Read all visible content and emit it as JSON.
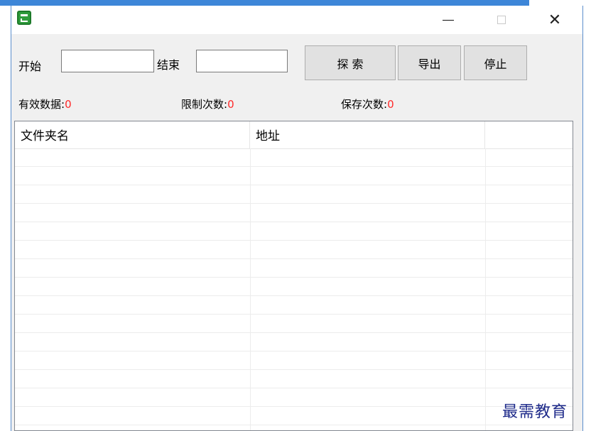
{
  "window": {
    "minimize_glyph": "—",
    "maximize_glyph": "□",
    "close_glyph": "✕"
  },
  "form": {
    "start_label": "开始",
    "start_value": "",
    "end_label": "结束",
    "end_value": ""
  },
  "buttons": {
    "search": "探 索",
    "export": "导出",
    "stop": "停止"
  },
  "stats": {
    "valid_label": "有效数据:",
    "valid_value": "0",
    "limit_label": "限制次数:",
    "limit_value": "0",
    "save_label": "保存次数:",
    "save_value": "0"
  },
  "table": {
    "columns": [
      "文件夹名",
      "地址",
      ""
    ],
    "rows": []
  },
  "watermark": "最需教育",
  "colors": {
    "accent": "#3d86d8",
    "stat_value": "#ff2a2a",
    "app_icon": "#2f9c3c"
  }
}
